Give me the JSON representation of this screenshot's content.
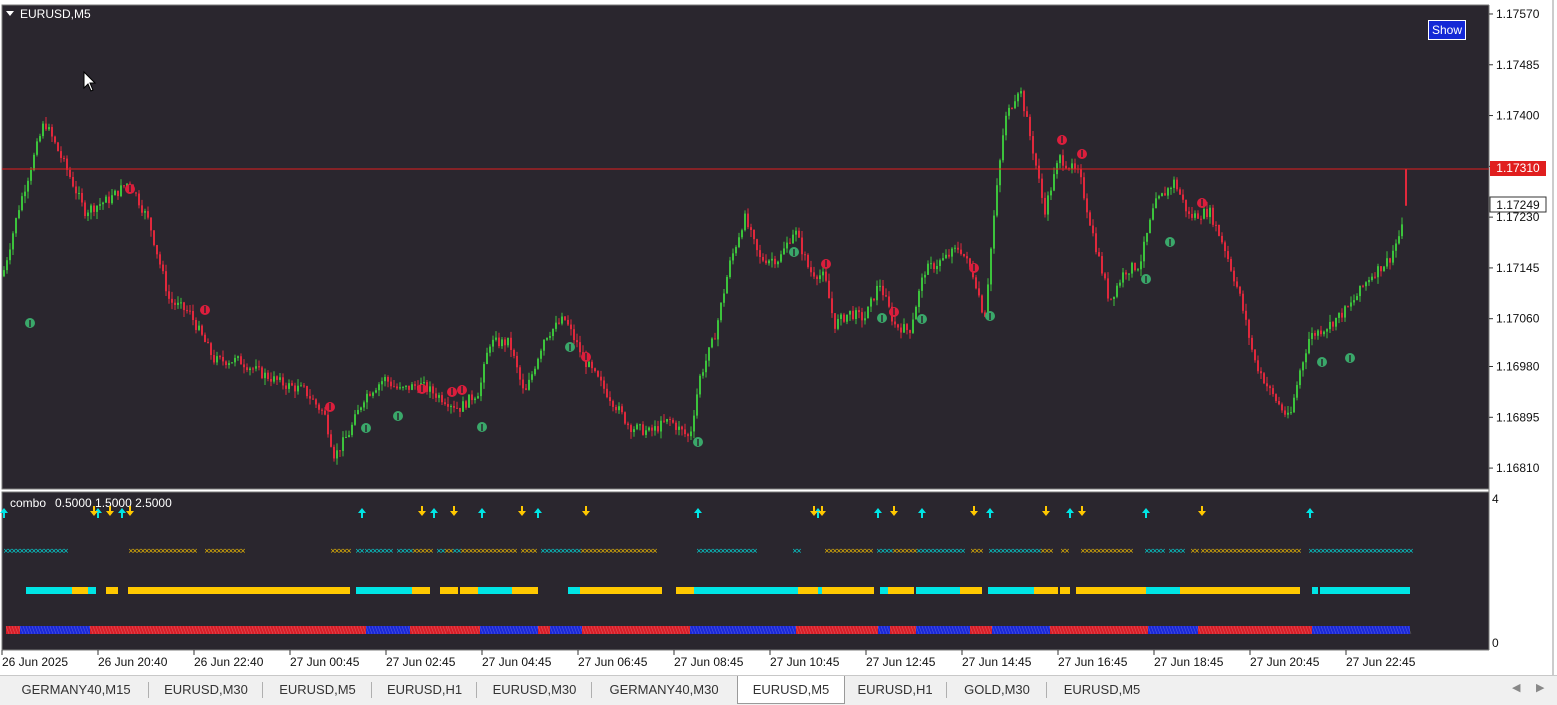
{
  "chart_window": {
    "symbol_label": "EURUSD,M5",
    "show_button_label": "Show",
    "current_price_label": "1.17310",
    "last_price_label": "1.17249"
  },
  "price_axis": {
    "labels": [
      "1.17570",
      "1.17485",
      "1.17400",
      "1.17315",
      "1.17230",
      "1.17145",
      "1.17060",
      "1.16980",
      "1.16895",
      "1.16810"
    ],
    "range": [
      1.1678,
      1.1758
    ]
  },
  "indicator": {
    "title": "combo",
    "params": "0.5000 1.5000 2.5000",
    "axis_labels": [
      "4",
      "0"
    ]
  },
  "time_axis": {
    "labels": [
      "26 Jun 2025",
      "26 Jun 20:40",
      "26 Jun 22:40",
      "27 Jun 00:45",
      "27 Jun 02:45",
      "27 Jun 04:45",
      "27 Jun 06:45",
      "27 Jun 08:45",
      "27 Jun 10:45",
      "27 Jun 12:45",
      "27 Jun 14:45",
      "27 Jun 16:45",
      "27 Jun 18:45",
      "27 Jun 20:45",
      "27 Jun 22:45"
    ]
  },
  "tabs": [
    "GERMANY40,M15",
    "EURUSD,M30",
    "EURUSD,M5",
    "EURUSD,H1",
    "EURUSD,M30",
    "GERMANY40,M30",
    "EURUSD,M5",
    "EURUSD,H1",
    "GOLD,M30",
    "EURUSD,M5"
  ],
  "active_tab_index": 6,
  "colors": {
    "chart_bg": "#2a262e",
    "bull": "#3cc33c",
    "bear": "#e0283c",
    "price_line": "#e01e1e",
    "cyan": "#00e5e5",
    "gold": "#ffc800",
    "blue": "#1a28d8",
    "red": "#d81e28",
    "buy_marker": "#3aa86a",
    "sell_marker": "#dc1e3c"
  },
  "chart_data": {
    "type": "candlestick",
    "y_range": [
      1.1678,
      1.1758
    ],
    "anchors": [
      [
        0,
        1.1711
      ],
      [
        20,
        1.1725
      ],
      [
        45,
        1.1739
      ],
      [
        70,
        1.173
      ],
      [
        85,
        1.1724
      ],
      [
        110,
        1.1726
      ],
      [
        130,
        1.1729
      ],
      [
        150,
        1.1722
      ],
      [
        170,
        1.1709
      ],
      [
        190,
        1.1707
      ],
      [
        215,
        1.1699
      ],
      [
        240,
        1.1699
      ],
      [
        260,
        1.1697
      ],
      [
        285,
        1.1695
      ],
      [
        305,
        1.1694
      ],
      [
        325,
        1.169
      ],
      [
        335,
        1.1683
      ],
      [
        350,
        1.1687
      ],
      [
        365,
        1.1693
      ],
      [
        385,
        1.1696
      ],
      [
        400,
        1.1694
      ],
      [
        420,
        1.1695
      ],
      [
        440,
        1.1693
      ],
      [
        460,
        1.1691
      ],
      [
        480,
        1.1694
      ],
      [
        490,
        1.1702
      ],
      [
        510,
        1.1702
      ],
      [
        525,
        1.1693
      ],
      [
        545,
        1.1703
      ],
      [
        565,
        1.1706
      ],
      [
        585,
        1.1699
      ],
      [
        610,
        1.1693
      ],
      [
        630,
        1.1688
      ],
      [
        650,
        1.1687
      ],
      [
        670,
        1.1689
      ],
      [
        690,
        1.1686
      ],
      [
        700,
        1.1696
      ],
      [
        715,
        1.1703
      ],
      [
        730,
        1.1715
      ],
      [
        745,
        1.1723
      ],
      [
        760,
        1.1716
      ],
      [
        780,
        1.1716
      ],
      [
        795,
        1.1721
      ],
      [
        810,
        1.1714
      ],
      [
        825,
        1.1713
      ],
      [
        835,
        1.1705
      ],
      [
        850,
        1.1707
      ],
      [
        865,
        1.1706
      ],
      [
        880,
        1.1712
      ],
      [
        895,
        1.1705
      ],
      [
        910,
        1.1704
      ],
      [
        925,
        1.1714
      ],
      [
        945,
        1.1716
      ],
      [
        960,
        1.1718
      ],
      [
        975,
        1.1713
      ],
      [
        985,
        1.1706
      ],
      [
        995,
        1.1724
      ],
      [
        1005,
        1.1739
      ],
      [
        1020,
        1.1745
      ],
      [
        1035,
        1.1733
      ],
      [
        1045,
        1.1724
      ],
      [
        1060,
        1.1733
      ],
      [
        1080,
        1.173
      ],
      [
        1095,
        1.1719
      ],
      [
        1110,
        1.1709
      ],
      [
        1125,
        1.1714
      ],
      [
        1140,
        1.1715
      ],
      [
        1155,
        1.1725
      ],
      [
        1175,
        1.1729
      ],
      [
        1190,
        1.1723
      ],
      [
        1210,
        1.1724
      ],
      [
        1225,
        1.1718
      ],
      [
        1240,
        1.171
      ],
      [
        1255,
        1.1699
      ],
      [
        1270,
        1.1694
      ],
      [
        1290,
        1.1689
      ],
      [
        1300,
        1.1697
      ],
      [
        1310,
        1.1703
      ],
      [
        1330,
        1.1705
      ],
      [
        1350,
        1.1708
      ],
      [
        1370,
        1.1713
      ],
      [
        1390,
        1.1716
      ],
      [
        1405,
        1.1722
      ]
    ],
    "last_candle": {
      "open": 1.1731,
      "close": 1.17249
    }
  }
}
